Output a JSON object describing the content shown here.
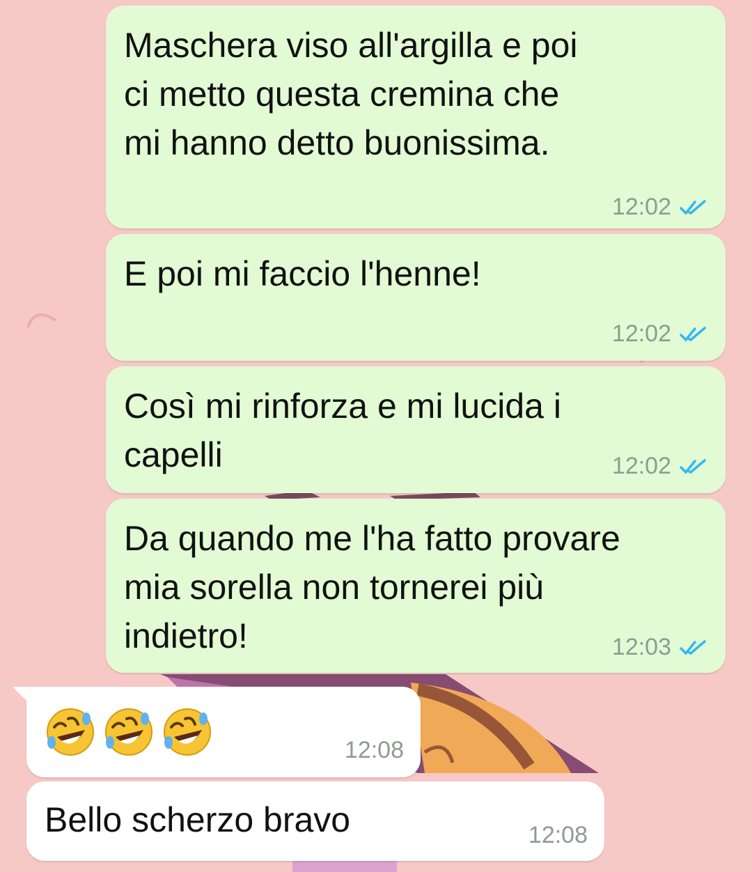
{
  "colors": {
    "wallpaper": "#f6c8c6",
    "outgoing_bubble": "#e2fbd4",
    "incoming_bubble": "#ffffff",
    "read_ticks": "#34b7f1",
    "timestamp": "#8f9a93"
  },
  "messages": [
    {
      "direction": "outgoing",
      "text": "Maschera viso all'argilla e poi\nci metto questa cremina che\nmi hanno detto buonissima.",
      "time": "12:02",
      "status": "read",
      "status_icon": "double-check-icon"
    },
    {
      "direction": "outgoing",
      "text": "E poi mi faccio l'henne!",
      "time": "12:02",
      "status": "read",
      "status_icon": "double-check-icon"
    },
    {
      "direction": "outgoing",
      "text": "Così mi rinforza e mi lucida i\ncapelli",
      "time": "12:02",
      "status": "read",
      "status_icon": "double-check-icon"
    },
    {
      "direction": "outgoing",
      "text": "Da quando me l'ha fatto provare\nmia sorella non tornerei più\nindietro!",
      "time": "12:03",
      "status": "read",
      "status_icon": "double-check-icon"
    },
    {
      "direction": "incoming",
      "emoji": [
        "rolling-on-floor-laughing-emoji",
        "rolling-on-floor-laughing-emoji",
        "rolling-on-floor-laughing-emoji"
      ],
      "time": "12:08"
    },
    {
      "direction": "incoming",
      "text": "Bello scherzo bravo",
      "time": "12:08"
    }
  ]
}
